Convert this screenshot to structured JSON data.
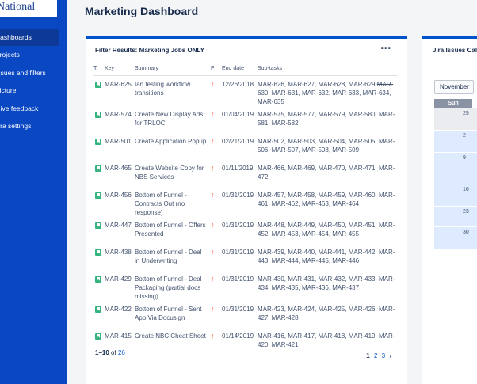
{
  "sidebar": {
    "logo_text": "National",
    "items": [
      {
        "label": "Dashboards",
        "active": true
      },
      {
        "label": "Projects"
      },
      {
        "label": "Issues and filters"
      },
      {
        "label": "Picture"
      },
      {
        "label": "Give feedback"
      },
      {
        "label": "Jira settings"
      }
    ]
  },
  "page": {
    "title": "Marketing Dashboard"
  },
  "filter_gadget": {
    "title": "Filter Results: Marketing Jobs ONLY",
    "menu_label": "•••",
    "columns": [
      "T",
      "Key",
      "Summary",
      "P",
      "End date",
      "Sub-tasks"
    ],
    "rows": [
      {
        "key": "MAR-625",
        "summary": "Ian testing workflow transitions",
        "end": "12/26/2018",
        "sub_pre": "MAR-626, MAR-627, MAR-628, MAR-629,",
        "sub_strike": "MAR-630",
        "sub_post": ", MAR-631, MAR-632, MAR-633, MAR-634, MAR-635"
      },
      {
        "key": "MAR-574",
        "summary": "Create New Display Ads for TRLOC",
        "end": "01/04/2019",
        "sub_pre": "MAR-575, MAR-577, MAR-579, MAR-580, MAR-581, MAR-582",
        "sub_strike": "",
        "sub_post": ""
      },
      {
        "key": "MAR-501",
        "summary": "Create Application Popup",
        "end": "02/21/2019",
        "sub_pre": "MAR-502, MAR-503, MAR-504, MAR-505, MAR-506, MAR-507, MAR-508, MAR-509",
        "sub_strike": "",
        "sub_post": ""
      },
      {
        "key": "MAR-465",
        "summary": "Create Website Copy for NBS Services",
        "end": "01/11/2019",
        "sub_pre": "MAR-466, MAR-469, MAR-470, MAR-471, MAR-472",
        "sub_strike": "",
        "sub_post": ""
      },
      {
        "key": "MAR-456",
        "summary": "Bottom of Funnel - Contracts Out (no response)",
        "end": "01/31/2019",
        "sub_pre": "MAR-457, MAR-458, MAR-459, MAR-460, MAR-461, MAR-462, MAR-463, MAR-464",
        "sub_strike": "",
        "sub_post": ""
      },
      {
        "key": "MAR-447",
        "summary": "Bottom of Funnel - Offers Presented",
        "end": "01/31/2019",
        "sub_pre": "MAR-448, MAR-449, MAR-450, MAR-451, MAR-452, MAR-453, MAR-454, MAR-455",
        "sub_strike": "",
        "sub_post": ""
      },
      {
        "key": "MAR-438",
        "summary": "Bottom of Funnel - Deal in Underwriting",
        "end": "01/31/2019",
        "sub_pre": "MAR-439, MAR-440, MAR-441, MAR-442, MAR-443, MAR-444, MAR-445, MAR-446",
        "sub_strike": "",
        "sub_post": ""
      },
      {
        "key": "MAR-429",
        "summary": "Bottom of Funnel - Deal Packaging (partial docs missing)",
        "end": "01/31/2019",
        "sub_pre": "MAR-430, MAR-431, MAR-432, MAR-433, MAR-434, MAR-435, MAR-436, MAR-437",
        "sub_strike": "",
        "sub_post": ""
      },
      {
        "key": "MAR-422",
        "summary": "Bottom of Funnel - Sent App Via Docusign",
        "end": "01/31/2019",
        "sub_pre": "MAR-423, MAR-424, MAR-425, MAR-426, MAR-427, MAR-428",
        "sub_strike": "",
        "sub_post": ""
      },
      {
        "key": "MAR-415",
        "summary": "Create NBC Cheat Sheet",
        "end": "01/14/2019",
        "sub_pre": "MAR-416, MAR-417, MAR-418, MAR-419, MAR-420, MAR-421",
        "sub_strike": "",
        "sub_post": ""
      }
    ],
    "footer": {
      "range": "1–10",
      "of_label": "of",
      "total": "26"
    },
    "pager": {
      "current": "1",
      "pages": [
        "2",
        "3"
      ],
      "next": "›"
    }
  },
  "calendar_gadget": {
    "title": "Jira Issues Cale",
    "month": "November",
    "day_header": "Sun",
    "days": [
      "25",
      "2",
      "9",
      "16",
      "23",
      "30"
    ]
  },
  "icons": {
    "story": "story-icon",
    "priority": "arrow-up-icon",
    "more": "more-icon"
  },
  "colors": {
    "sidebar": "#0a47c2",
    "accent": "#0052cc",
    "story": "#36b37e",
    "priority": "#ff5630"
  }
}
